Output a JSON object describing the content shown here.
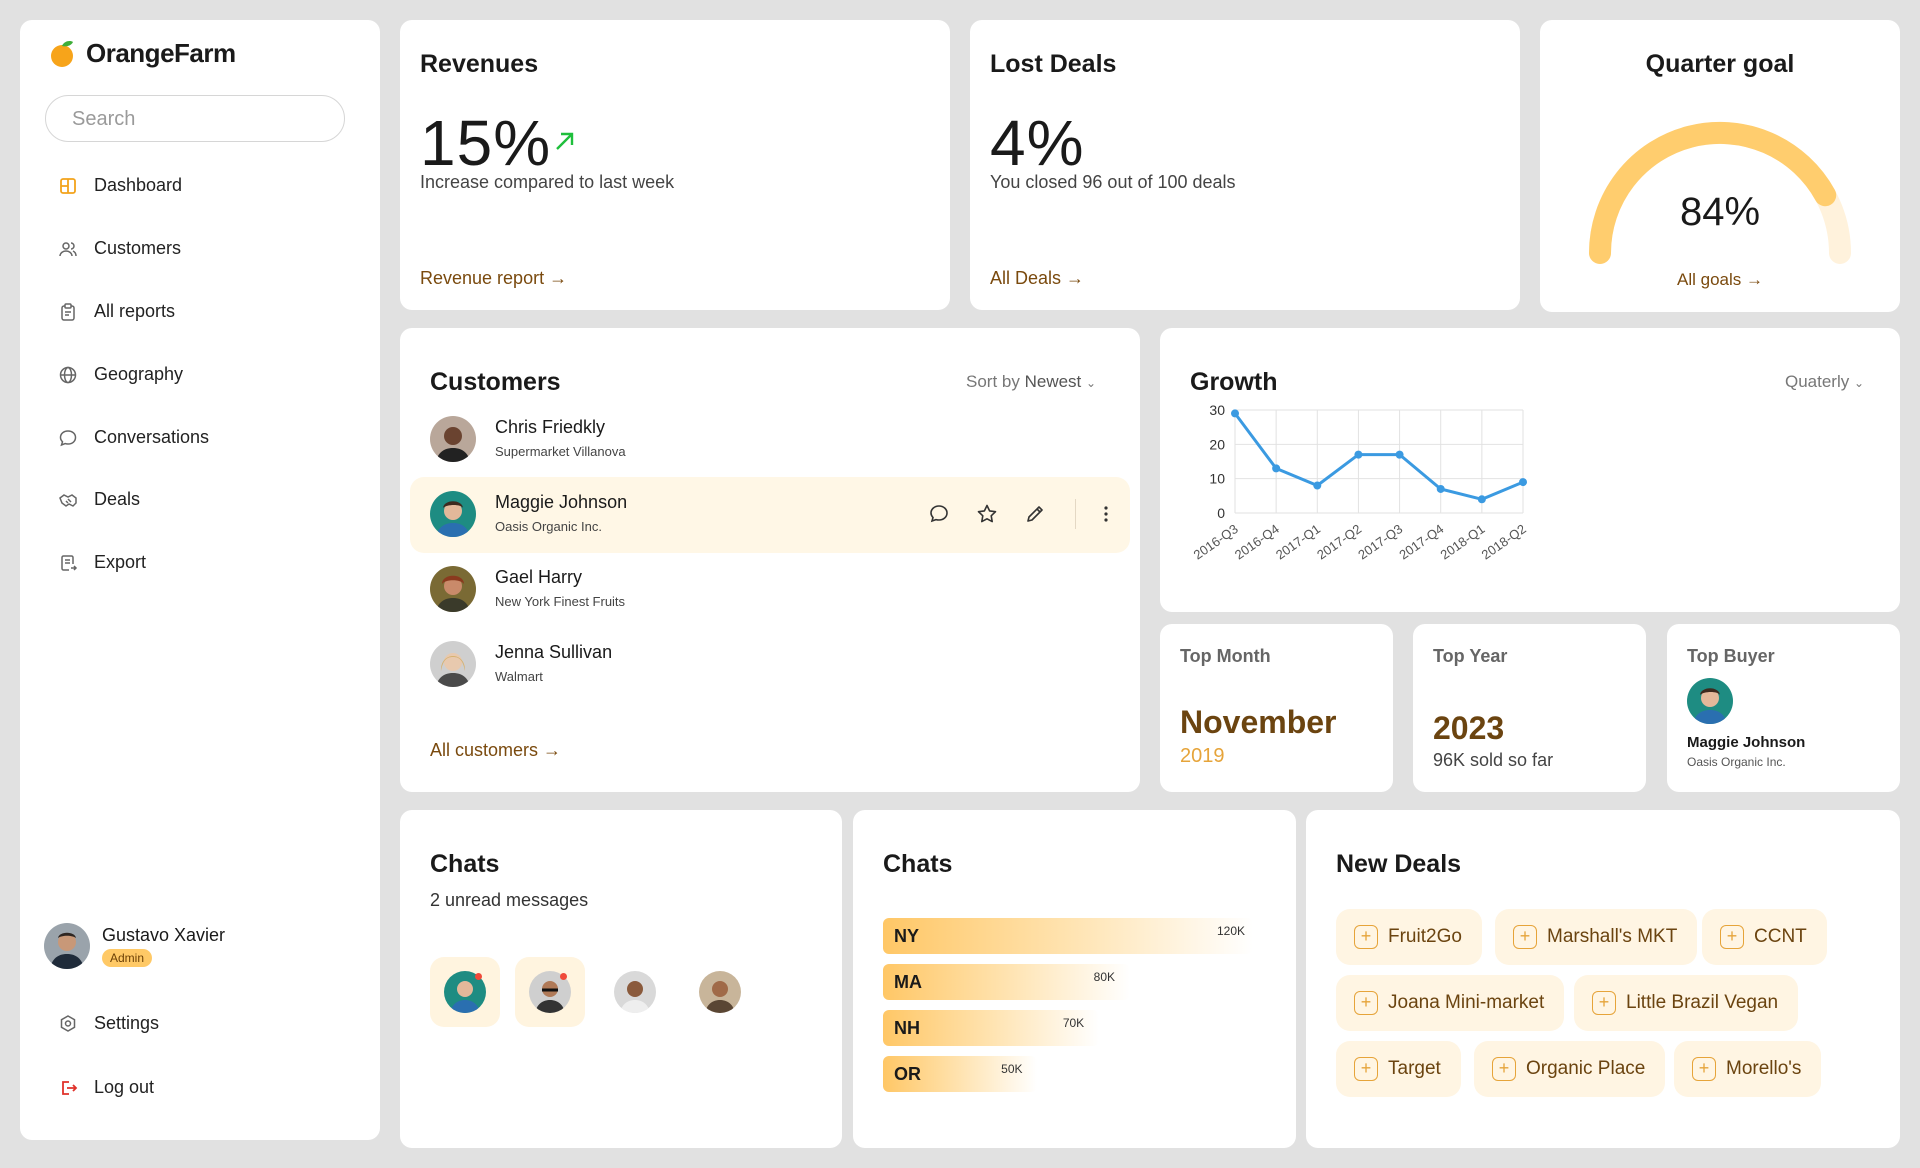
{
  "brand": {
    "name": "OrangeFarm"
  },
  "search": {
    "placeholder": "Search"
  },
  "nav": [
    {
      "label": "Dashboard",
      "icon": "dashboard-icon"
    },
    {
      "label": "Customers",
      "icon": "users-icon"
    },
    {
      "label": "All reports",
      "icon": "clipboard-icon"
    },
    {
      "label": "Geography",
      "icon": "globe-icon"
    },
    {
      "label": "Conversations",
      "icon": "chat-bubble-icon"
    },
    {
      "label": "Deals",
      "icon": "handshake-icon"
    },
    {
      "label": "Export",
      "icon": "export-icon"
    }
  ],
  "profile": {
    "name": "Gustavo Xavier",
    "role": "Admin"
  },
  "settings": {
    "label": "Settings"
  },
  "logout": {
    "label": "Log out"
  },
  "revenues": {
    "title": "Revenues",
    "value": "15%",
    "subtitle": "Increase compared to last week",
    "link": "Revenue report",
    "trend_icon": "arrow-up-right-icon"
  },
  "lost_deals": {
    "title": "Lost Deals",
    "value": "4%",
    "subtitle": "You closed 96 out of 100 deals",
    "link": "All Deals"
  },
  "quarter_goal": {
    "title": "Quarter goal",
    "value": "84%",
    "progress": 0.84,
    "link": "All goals"
  },
  "customers": {
    "title": "Customers",
    "sort_prefix": "Sort by",
    "sort_value": "Newest",
    "link": "All customers",
    "items": [
      {
        "name": "Chris Friedkly",
        "company": "Supermarket Villanova"
      },
      {
        "name": "Maggie Johnson",
        "company": "Oasis Organic Inc."
      },
      {
        "name": "Gael Harry",
        "company": "New York Finest Fruits"
      },
      {
        "name": "Jenna Sullivan",
        "company": "Walmart"
      }
    ]
  },
  "growth": {
    "title": "Growth",
    "period": "Quaterly"
  },
  "chart_data": {
    "type": "line",
    "x": [
      "2016-Q3",
      "2016-Q4",
      "2017-Q1",
      "2017-Q2",
      "2017-Q3",
      "2017-Q4",
      "2018-Q1",
      "2018-Q2"
    ],
    "series": [
      {
        "values": [
          29,
          13,
          8,
          17,
          17,
          7,
          4,
          9
        ]
      }
    ],
    "ylim": [
      0,
      30
    ],
    "yticks": [
      0,
      10,
      20,
      30
    ],
    "grid": true,
    "color": "#3b9ae1"
  },
  "top_month": {
    "label": "Top Month",
    "value": "November",
    "year": "2019"
  },
  "top_year": {
    "label": "Top Year",
    "value": "2023",
    "sub": "96K sold so far"
  },
  "top_buyer": {
    "label": "Top Buyer",
    "name": "Maggie Johnson",
    "company": "Oasis Organic Inc."
  },
  "chats": {
    "title": "Chats",
    "subtitle": "2 unread messages"
  },
  "chats_bars": {
    "title": "Chats",
    "max": 120,
    "items": [
      {
        "label": "NY",
        "value": 120,
        "display": "120K"
      },
      {
        "label": "MA",
        "value": 80,
        "display": "80K"
      },
      {
        "label": "NH",
        "value": 70,
        "display": "70K"
      },
      {
        "label": "OR",
        "value": 50,
        "display": "50K"
      }
    ]
  },
  "new_deals": {
    "title": "New Deals",
    "items": [
      "Fruit2Go",
      "Marshall's MKT",
      "CCNT",
      "Joana Mini-market",
      "Little Brazil Vegan",
      "Target",
      "Organic Place",
      "Morello's"
    ]
  },
  "colors": {
    "accent": "#ffc966",
    "brown": "#7a4a0e",
    "trend_green": "#1fbf3c",
    "logout_red": "#e0322b"
  }
}
